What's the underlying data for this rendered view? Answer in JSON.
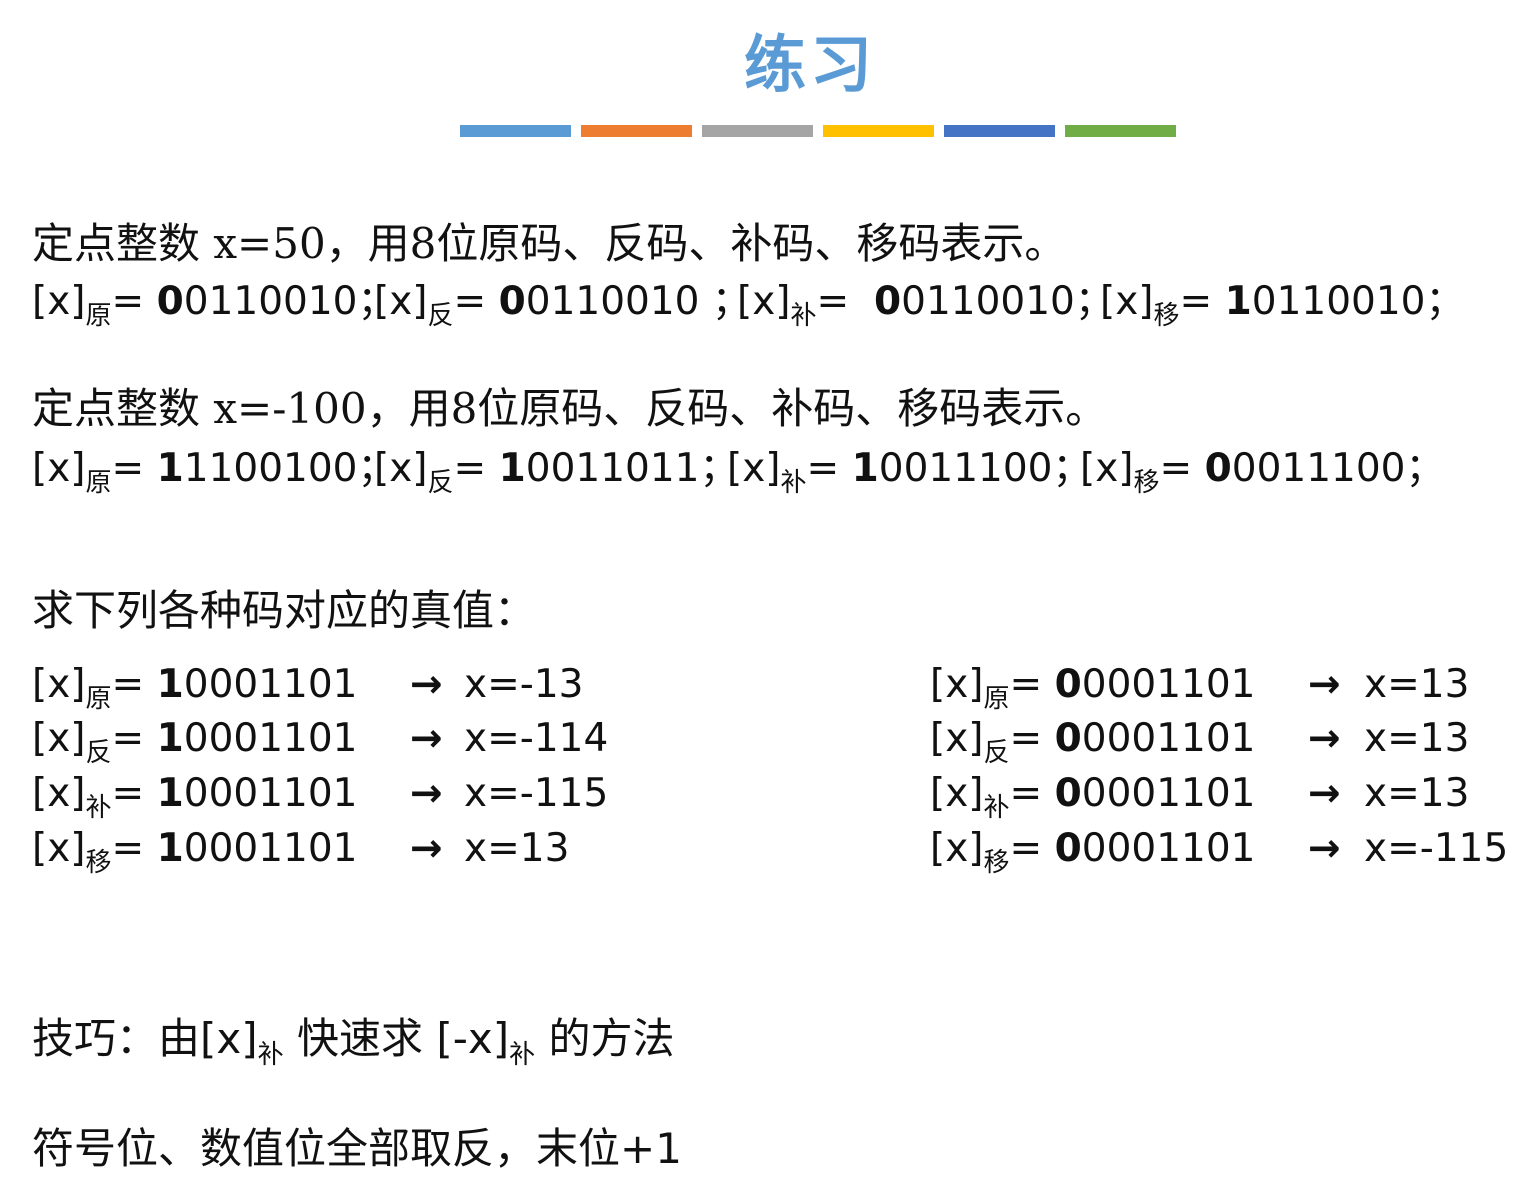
{
  "title": "练习",
  "title_color": "#5B9BD5",
  "color_bar": [
    {
      "color": "#5B9BD5"
    },
    {
      "color": "#ED7D31"
    },
    {
      "color": "#A5A5A5"
    },
    {
      "color": "#FFC000"
    },
    {
      "color": "#4472C4"
    },
    {
      "color": "#70AD47"
    }
  ],
  "q1": {
    "heading": "定点整数 x=50，用8位原码、反码、补码、移码表示。",
    "codes": [
      {
        "prefix": "[x]",
        "sub": "原",
        "eq": "= ",
        "lead": "0",
        "rest": "0110010",
        "end": "；"
      },
      {
        "prefix": "[x]",
        "sub": "反",
        "eq": "= ",
        "lead": "0",
        "rest": "0110010",
        "end": " ；"
      },
      {
        "prefix": "[x]",
        "sub": "补",
        "eq": "=  ",
        "lead": "0",
        "rest": "0110010",
        "end": "；"
      },
      {
        "prefix": "[x]",
        "sub": "移",
        "eq": "= ",
        "lead": "1",
        "rest": "0110010",
        "end": "；"
      }
    ]
  },
  "q2": {
    "heading": "定点整数 x=-100，用8位原码、反码、补码、移码表示。",
    "codes": [
      {
        "prefix": "[x]",
        "sub": "原",
        "eq": "= ",
        "lead": "1",
        "rest": "1100100",
        "end": "；"
      },
      {
        "prefix": "[x]",
        "sub": "反",
        "eq": "= ",
        "lead": "1",
        "rest": "0011011",
        "end": "；"
      },
      {
        "prefix": "[x]",
        "sub": "补",
        "eq": "= ",
        "lead": "1",
        "rest": "0011100",
        "end": "；"
      },
      {
        "prefix": "[x]",
        "sub": "移",
        "eq": "= ",
        "lead": "0",
        "rest": "0011100",
        "end": "；"
      }
    ]
  },
  "q3": {
    "heading": "求下列各种码对应的真值：",
    "arrow": "→",
    "left": [
      {
        "prefix": "[x]",
        "sub": "原",
        "eq": "= ",
        "lead": "1",
        "rest": "0001101",
        "value": "x=-13"
      },
      {
        "prefix": "[x]",
        "sub": "反",
        "eq": "= ",
        "lead": "1",
        "rest": "0001101",
        "value": "x=-114"
      },
      {
        "prefix": "[x]",
        "sub": "补",
        "eq": "= ",
        "lead": "1",
        "rest": "0001101",
        "value": "x=-115"
      },
      {
        "prefix": "[x]",
        "sub": "移",
        "eq": "= ",
        "lead": "1",
        "rest": "0001101",
        "value": "x=13"
      }
    ],
    "right": [
      {
        "prefix": "[x]",
        "sub": "原",
        "eq": "= ",
        "lead": "0",
        "rest": "0001101",
        "value": "x=13"
      },
      {
        "prefix": "[x]",
        "sub": "反",
        "eq": "= ",
        "lead": "0",
        "rest": "0001101",
        "value": "x=13"
      },
      {
        "prefix": "[x]",
        "sub": "补",
        "eq": "= ",
        "lead": "0",
        "rest": "0001101",
        "value": "x=13"
      },
      {
        "prefix": "[x]",
        "sub": "移",
        "eq": "= ",
        "lead": "0",
        "rest": "0001101",
        "value": "x=-115"
      }
    ]
  },
  "tip": {
    "t1": "技巧：由",
    "t2": "[x]",
    "t2_sub": "补",
    "t3": " 快速求 ",
    "t4": "[-x]",
    "t4_sub": "补",
    "t5": " 的方法"
  },
  "rule": {
    "text": "符号位、数值位全部取反，末位",
    "tail": "+1"
  }
}
